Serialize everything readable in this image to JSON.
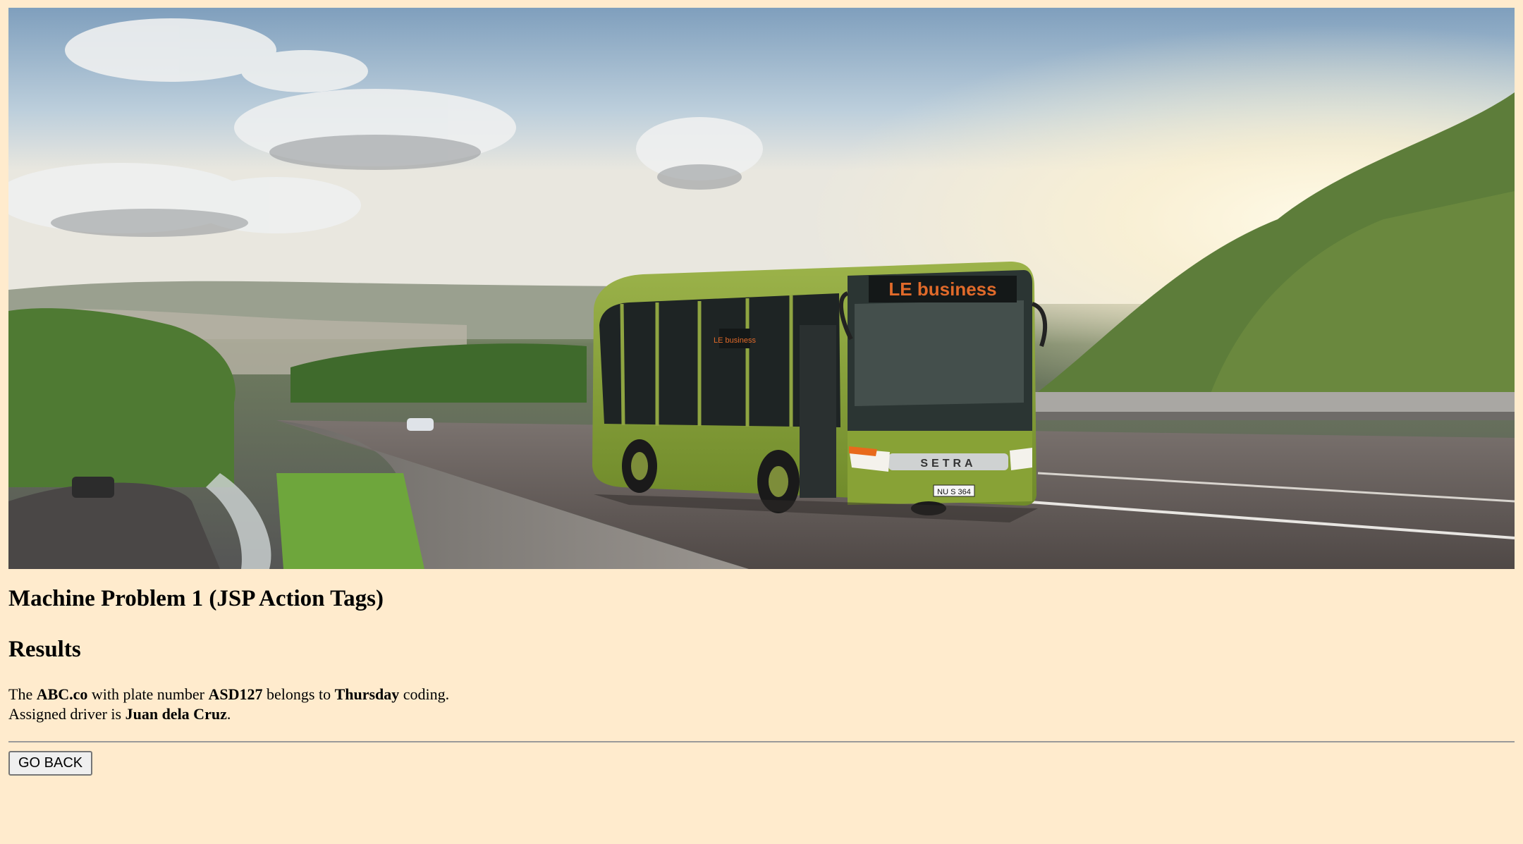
{
  "banner": {
    "image": "bus-on-highway-photo",
    "destination_sign": "LE business",
    "side_sign": "LE business",
    "brand": "SETRA",
    "plate": "NU S 364"
  },
  "title": "Machine Problem 1 (JSP Action Tags)",
  "results_heading": "Results",
  "result": {
    "prefix": "The ",
    "company": "ABC.co",
    "mid1": " with plate number ",
    "plate_number": "ASD127",
    "mid2": " belongs to ",
    "coding_day": "Thursday",
    "suffix1": " coding.",
    "driver_prefix": "Assigned driver is ",
    "driver": "Juan dela Cruz",
    "suffix2": "."
  },
  "buttons": {
    "go_back": "GO BACK"
  }
}
